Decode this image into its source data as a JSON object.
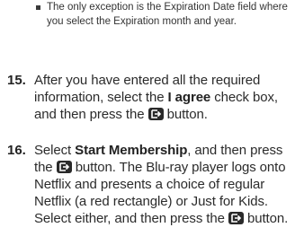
{
  "sub_bullet": {
    "text": "The only exception is the Expiration Date field where you select the Expiration month and year."
  },
  "steps": [
    {
      "number": "15.",
      "text_before": "After you have entered all the required information, select the ",
      "bold": "I agree",
      "text_after": " check box, and then press the ",
      "text_end": " button."
    },
    {
      "number": "16.",
      "text_start": "Select ",
      "bold": "Start Membership",
      "text_before_btn1": ", and then press the ",
      "text_after_btn1": " button. The Blu-ray player logs onto Netflix and presents a choice of regular Netflix (a red rectangle) or Just for Kids. Select either, and then press the ",
      "text_end": " button."
    }
  ]
}
